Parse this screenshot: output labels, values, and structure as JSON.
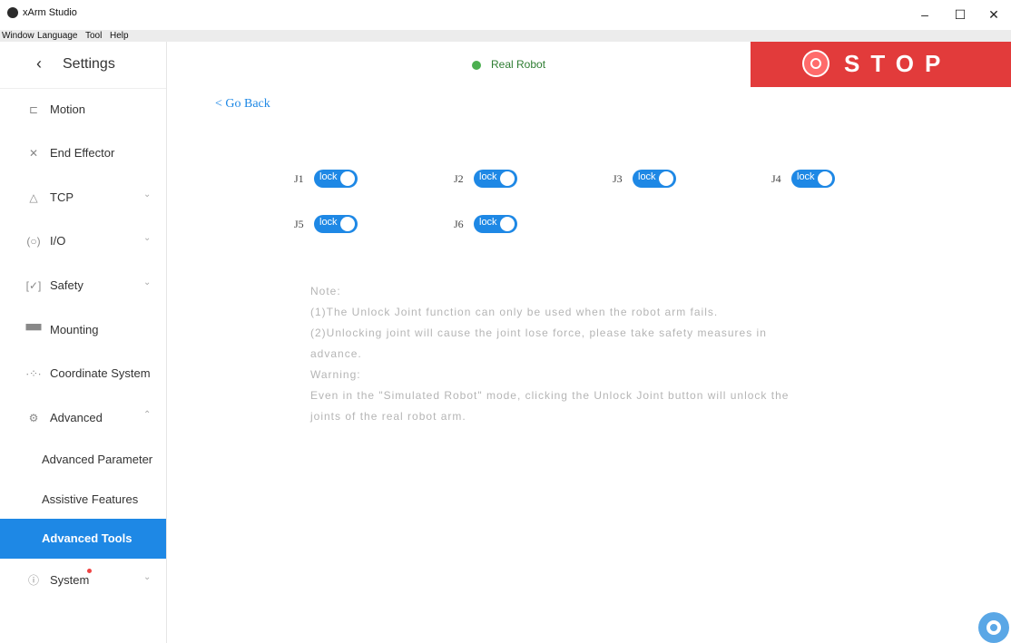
{
  "app": {
    "title": "xArm Studio"
  },
  "menu": [
    "Window",
    "Language",
    "Tool",
    "Help"
  ],
  "window_controls": {
    "minimize": "–",
    "maximize": "☐",
    "close": "✕"
  },
  "sidebar": {
    "title": "Settings",
    "items": [
      {
        "label": "Motion",
        "icon": "motion-icon"
      },
      {
        "label": "End Effector",
        "icon": "end-effector-icon"
      },
      {
        "label": "TCP",
        "icon": "tcp-icon",
        "expandable": true
      },
      {
        "label": "I/O",
        "icon": "io-icon",
        "expandable": true
      },
      {
        "label": "Safety",
        "icon": "safety-icon",
        "expandable": true
      },
      {
        "label": "Mounting",
        "icon": "mounting-icon"
      },
      {
        "label": "Coordinate System",
        "icon": "coordinate-icon"
      },
      {
        "label": "Advanced",
        "icon": "advanced-icon",
        "expanded": true
      }
    ],
    "subitems": [
      "Advanced Parameter",
      "Assistive Features",
      "Advanced Tools"
    ],
    "active_subitem": "Advanced Tools",
    "system": {
      "label": "System",
      "icon": "info-icon",
      "notification": true
    }
  },
  "status": {
    "label": "Real Robot",
    "color": "#4caf50"
  },
  "stop_button": {
    "label": "STOP",
    "color": "#e23b3b"
  },
  "go_back": "< Go Back",
  "joints": [
    {
      "label": "J1",
      "state": "lock"
    },
    {
      "label": "J2",
      "state": "lock"
    },
    {
      "label": "J3",
      "state": "lock"
    },
    {
      "label": "J4",
      "state": "lock"
    },
    {
      "label": "J5",
      "state": "lock"
    },
    {
      "label": "J6",
      "state": "lock"
    }
  ],
  "note_lines": [
    "Note:",
    "(1)The Unlock Joint function can only be used when the robot arm fails.",
    "(2)Unlocking joint will cause the joint lose force, please take safety measures in",
    "advance.",
    "Warning:",
    "Even in the \"Simulated Robot\" mode, clicking the Unlock Joint button will unlock the",
    "joints of the real robot arm."
  ],
  "accent_color": "#1e88e5"
}
